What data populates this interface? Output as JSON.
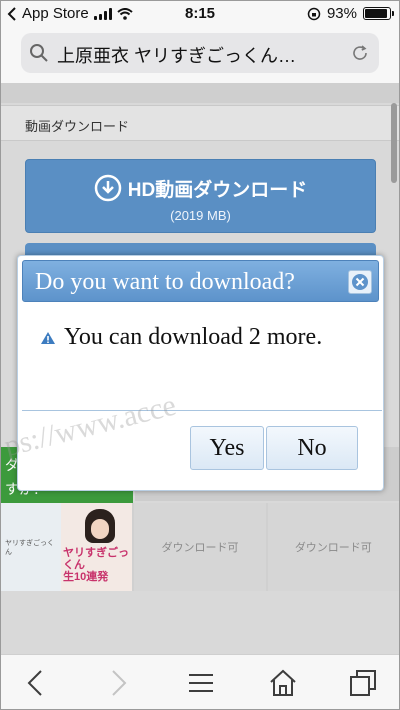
{
  "status_bar": {
    "carrier": "App Store",
    "time": "8:15",
    "battery": "93%",
    "battery_level": 0.93
  },
  "url_bar": {
    "text": "上原亜衣 ヤリすぎごっくん…"
  },
  "page": {
    "section_header": "動画ダウンロード",
    "hd_button": {
      "label": "HD動画ダウンロード",
      "size": "(2019 MB)"
    },
    "green_banner_text": "ダ\nすか？",
    "grid": [
      {
        "type": "thumbnail",
        "title": "ヤリすぎごっくん",
        "subtitle": "生10連発"
      },
      {
        "type": "download",
        "label": "ダウンロード可"
      },
      {
        "type": "download",
        "label": "ダウンロード可"
      }
    ],
    "watermark": "ps://www.acce"
  },
  "modal": {
    "title": "Do you want to download?",
    "message": "You can download 2 more.",
    "yes_label": "Yes",
    "no_label": "No"
  },
  "colors": {
    "accent_blue": "#5a8fc4",
    "banner_green": "#3c9a3c"
  },
  "icons": [
    "search-icon",
    "reload-icon",
    "download-arrow-icon",
    "close-icon",
    "warning-icon",
    "back-icon",
    "forward-icon",
    "menu-icon",
    "home-icon",
    "tabs-icon",
    "wifi-icon",
    "signal-icon",
    "rotation-lock-icon",
    "battery-icon"
  ]
}
